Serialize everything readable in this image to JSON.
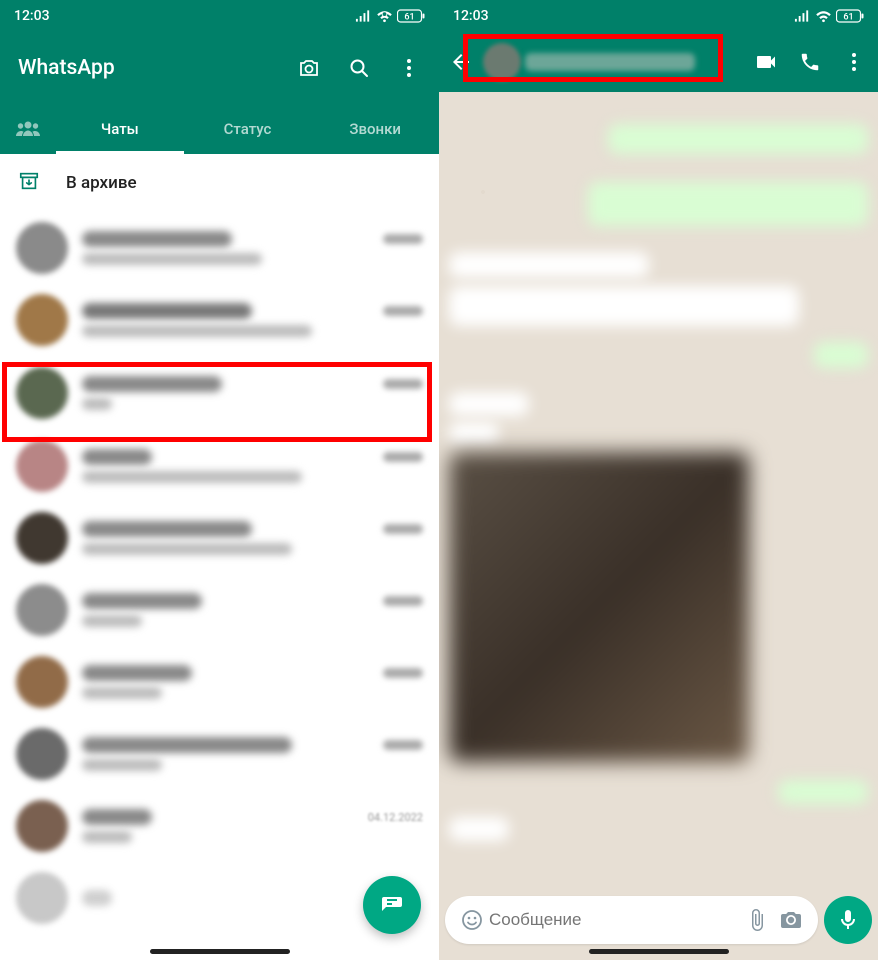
{
  "status": {
    "time": "12:03",
    "battery": "61"
  },
  "left": {
    "title": "WhatsApp",
    "tabs": {
      "chats": "Чаты",
      "status": "Статус",
      "calls": "Звонки"
    },
    "archive": "В архиве"
  },
  "right": {
    "input_placeholder": "Сообщение"
  }
}
